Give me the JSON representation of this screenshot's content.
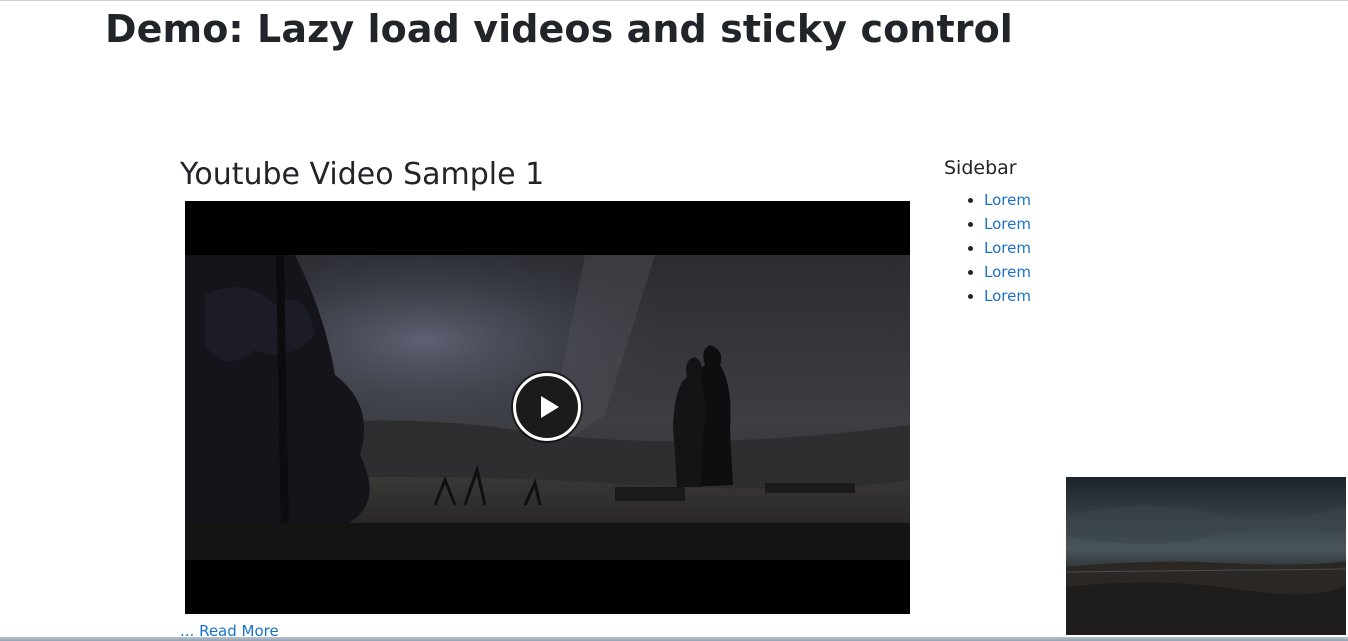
{
  "page": {
    "title": "Demo: Lazy load videos and sticky control"
  },
  "article": {
    "title": "Youtube Video Sample 1",
    "read_more": "... Read More"
  },
  "video": {
    "play_icon": "play-icon"
  },
  "sidebar": {
    "title": "Sidebar",
    "items": [
      {
        "label": "Lorem"
      },
      {
        "label": "Lorem"
      },
      {
        "label": "Lorem"
      },
      {
        "label": "Lorem"
      },
      {
        "label": "Lorem"
      }
    ]
  },
  "colors": {
    "link": "#1a73c8",
    "text": "#212529",
    "video_bg": "#000000"
  }
}
